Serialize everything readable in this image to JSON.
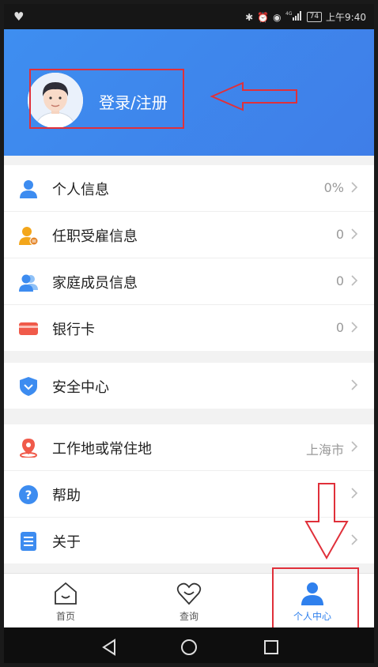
{
  "status_bar": {
    "battery": "74",
    "time": "上午9:40",
    "network": "4G"
  },
  "header": {
    "login_label": "登录/注册",
    "accent": "#3f87ee"
  },
  "menu": {
    "group1": [
      {
        "label": "个人信息",
        "value": "0%",
        "icon": "person-icon",
        "color": "#3d8cf0"
      },
      {
        "label": "任职受雇信息",
        "value": "0",
        "icon": "employee-icon",
        "color": "#f3a61b"
      },
      {
        "label": "家庭成员信息",
        "value": "0",
        "icon": "family-icon",
        "color": "#3d8cf0"
      },
      {
        "label": "银行卡",
        "value": "0",
        "icon": "bank-card-icon",
        "color": "#f05a4a"
      }
    ],
    "group2": [
      {
        "label": "安全中心",
        "value": "",
        "icon": "shield-icon",
        "color": "#3d8cf0"
      }
    ],
    "group3": [
      {
        "label": "工作地或常住地",
        "value": "上海市",
        "icon": "location-pin-icon",
        "color": "#f05a4a"
      },
      {
        "label": "帮助",
        "value": "",
        "icon": "help-icon",
        "color": "#3d8cf0"
      },
      {
        "label": "关于",
        "value": "",
        "icon": "document-icon",
        "color": "#3d8cf0"
      }
    ]
  },
  "tabs": [
    {
      "label": "首页",
      "icon": "home-icon"
    },
    {
      "label": "查询",
      "icon": "heart-icon"
    },
    {
      "label": "个人中心",
      "icon": "person-icon",
      "active": true
    }
  ],
  "colors": {
    "annotation": "#e0303a",
    "active_tab": "#2f80ed"
  }
}
